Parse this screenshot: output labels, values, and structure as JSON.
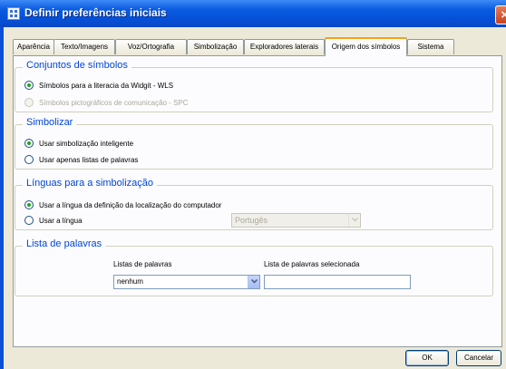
{
  "window": {
    "title": "Definir preferências iniciais"
  },
  "tabs": [
    {
      "label": "Aparência"
    },
    {
      "label": "Texto/Imagens"
    },
    {
      "label": "Voz/Ortografia"
    },
    {
      "label": "Simbolização"
    },
    {
      "label": "Exploradores laterais"
    },
    {
      "label": "Origem dos símbolos",
      "active": true
    },
    {
      "label": "Sistema"
    }
  ],
  "symbol_sets": {
    "title": "Conjuntos de símbolos",
    "options": [
      {
        "label": "Símbolos para a literacia da Widgit - WLS",
        "checked": true,
        "enabled": true
      },
      {
        "label": "Símbolos pictográficos de comunicação - SPC",
        "checked": false,
        "enabled": false
      }
    ]
  },
  "symbolize": {
    "title": "Simbolizar",
    "options": [
      {
        "label": "Usar simbolização inteligente",
        "checked": true
      },
      {
        "label": "Usar apenas listas de palavras",
        "checked": false
      }
    ]
  },
  "languages": {
    "title": "Línguas para a simbolização",
    "options": [
      {
        "label": "Usar a língua da definição da localização do computador",
        "checked": true
      },
      {
        "label": "Usar a língua",
        "checked": false
      }
    ],
    "language_select": {
      "value": "Portugês",
      "enabled": false
    }
  },
  "word_lists": {
    "title": "Lista de palavras",
    "lists_label": "Listas de palavras",
    "lists_value": "nenhum",
    "selected_label": "Lista de palavras selecionada",
    "selected_value": ""
  },
  "buttons": {
    "ok": "OK",
    "cancel": "Cancelar"
  },
  "colors": {
    "titlebar": "#0a5be0",
    "group_title": "#0046d5",
    "tab_highlight": "#f5a01a",
    "dialog_bg": "#ece9d8"
  }
}
